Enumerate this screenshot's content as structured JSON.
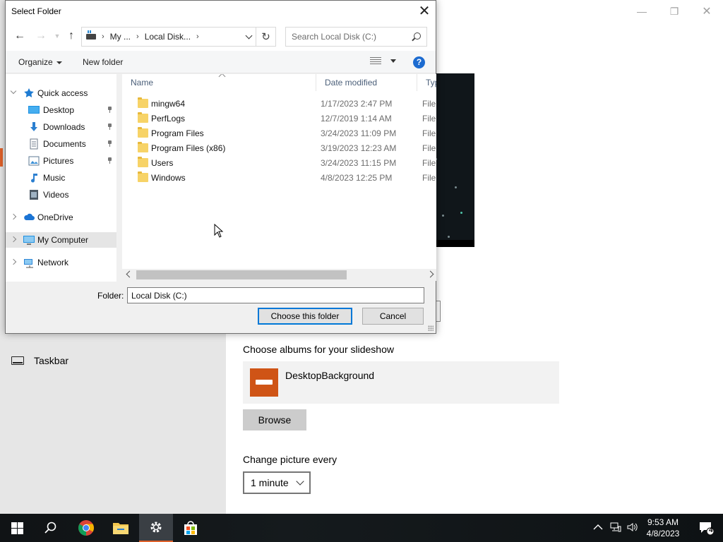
{
  "dialog": {
    "title": "Select Folder",
    "address": {
      "crumbs": [
        "My ...",
        "Local Disk..."
      ]
    },
    "search": {
      "placeholder": "Search Local Disk (C:)"
    },
    "toolbar": {
      "organize": "Organize",
      "new_folder": "New folder",
      "help": "?"
    },
    "tree": [
      {
        "label": "Quick access",
        "icon": "star-icon",
        "color": "#1e7bd2"
      },
      {
        "label": "Desktop",
        "icon": "desktop-icon",
        "pinned": true
      },
      {
        "label": "Downloads",
        "icon": "download-icon",
        "pinned": true
      },
      {
        "label": "Documents",
        "icon": "documents-icon",
        "pinned": true
      },
      {
        "label": "Pictures",
        "icon": "pictures-icon",
        "pinned": true
      },
      {
        "label": "Music",
        "icon": "music-icon"
      },
      {
        "label": "Videos",
        "icon": "videos-icon"
      },
      {
        "label": "OneDrive",
        "icon": "cloud-icon"
      },
      {
        "label": "My Computer",
        "icon": "computer-icon",
        "selected": true
      },
      {
        "label": "Network",
        "icon": "network-icon"
      }
    ],
    "columns": {
      "name": "Name",
      "date": "Date modified",
      "type": "Type"
    },
    "files": [
      {
        "name": "mingw64",
        "date": "1/17/2023 2:47 PM",
        "type": "File folder"
      },
      {
        "name": "PerfLogs",
        "date": "12/7/2019 1:14 AM",
        "type": "File folder"
      },
      {
        "name": "Program Files",
        "date": "3/24/2023 11:09 PM",
        "type": "File folder"
      },
      {
        "name": "Program Files (x86)",
        "date": "3/19/2023 12:23 AM",
        "type": "File folder"
      },
      {
        "name": "Users",
        "date": "3/24/2023 11:15 PM",
        "type": "File folder"
      },
      {
        "name": "Windows",
        "date": "4/8/2023 12:25 PM",
        "type": "File folder"
      }
    ],
    "folder_label": "Folder:",
    "folder_value": "Local Disk (C:)",
    "choose_button": "Choose this folder",
    "cancel_button": "Cancel"
  },
  "settings": {
    "taskbar_nav": "Taskbar",
    "albums_heading": "Choose albums for your slideshow",
    "album_name": "DesktopBackground",
    "browse_button": "Browse",
    "interval_heading": "Change picture every",
    "interval_value": "1 minute",
    "accent": "#e0622a"
  },
  "taskbar": {
    "time": "9:53 AM",
    "date": "4/8/2023",
    "notification_count": "4"
  }
}
